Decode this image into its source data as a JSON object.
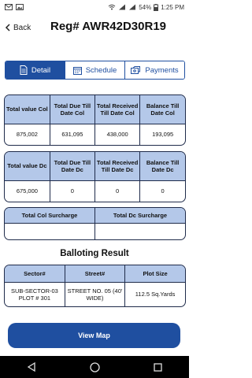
{
  "status_bar": {
    "battery": "54%",
    "time": "1:25 PM"
  },
  "header": {
    "back_label": "Back",
    "title": "Reg# AWR42D30R19"
  },
  "tabs": [
    {
      "label": "Detail",
      "active": true
    },
    {
      "label": "Schedule",
      "active": false
    },
    {
      "label": "Payments",
      "active": false
    }
  ],
  "col_table": {
    "headers": [
      "Total value Col",
      "Total Due Till Date Col",
      "Total Received Till Date Col",
      "Balance Till Date Col"
    ],
    "values": [
      "875,002",
      "631,095",
      "438,000",
      "193,095"
    ]
  },
  "dc_table": {
    "headers": [
      "Total value Dc",
      "Total Due Till Date Dc",
      "Total Received Till Date Dc",
      "Balance Till Date Dc"
    ],
    "values": [
      "675,000",
      "0",
      "0",
      "0"
    ]
  },
  "surcharge_table": {
    "headers": [
      "Total Col Surcharge",
      "Total Dc Surcharge"
    ],
    "values": [
      "",
      ""
    ]
  },
  "balloting": {
    "title": "Balloting Result",
    "headers": [
      "Sector#",
      "Street#",
      "Plot Size"
    ],
    "values": [
      "SUB-SECTOR-03 PLOT # 301",
      "STREET NO. 05 (40' WIDE)",
      "112.5 Sq.Yards"
    ]
  },
  "view_map_label": "View Map",
  "colors": {
    "primary": "#1f4fa0",
    "header_fill": "#b4c8e9",
    "border": "#1f2b4a"
  }
}
